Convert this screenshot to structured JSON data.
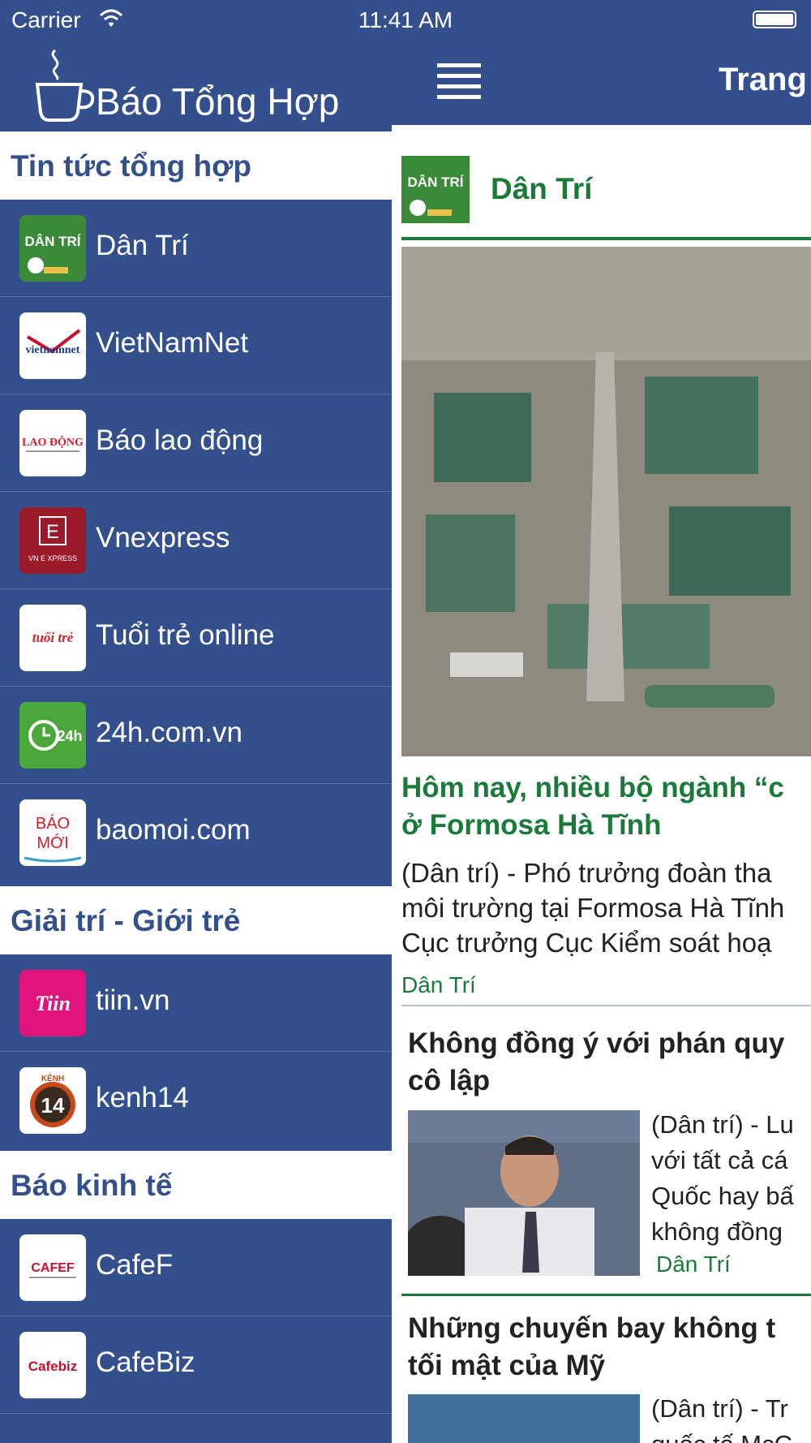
{
  "status_bar": {
    "carrier": "Carrier",
    "time": "11:41 AM"
  },
  "brand": {
    "title": "Báo Tổng Hợp"
  },
  "sidebar": {
    "sections": [
      {
        "title": "Tin tức tổng hợp",
        "items": [
          {
            "label": "Dân Trí",
            "logo": "dantri-logo"
          },
          {
            "label": "VietNamNet",
            "logo": "vietnamnet-logo"
          },
          {
            "label": "Báo lao động",
            "logo": "laodong-logo"
          },
          {
            "label": "Vnexpress",
            "logo": "vnexpress-logo"
          },
          {
            "label": "Tuổi trẻ online",
            "logo": "tuoitre-logo"
          },
          {
            "label": "24h.com.vn",
            "logo": "24h-logo"
          },
          {
            "label": "baomoi.com",
            "logo": "baomoi-logo"
          }
        ]
      },
      {
        "title": "Giải trí - Giới trẻ",
        "items": [
          {
            "label": "tiin.vn",
            "logo": "tiin-logo"
          },
          {
            "label": "kenh14",
            "logo": "kenh14-logo"
          }
        ]
      },
      {
        "title": "Báo kinh tế",
        "items": [
          {
            "label": "CafeF",
            "logo": "cafef-logo"
          },
          {
            "label": "CafeBiz",
            "logo": "cafebiz-logo"
          }
        ]
      }
    ]
  },
  "logo_text": {
    "dantri": "DÂN TRÍ",
    "vietnamnet": "vietnamnet",
    "laodong": "LAO ĐỘNG",
    "vnexpress_letter": "E",
    "vnexpress_small": "VN E XPRESS",
    "tuoitre": "tuổi trẻ",
    "h24": "24h",
    "baomoi_1": "BÁO",
    "baomoi_2": "MỚI",
    "tiin": "Tiin",
    "kenh14_top": "KÊNH",
    "kenh14_num": "14",
    "cafef": "CAFEF",
    "cafebiz": "Cafebiz"
  },
  "main": {
    "page_title": "Trang",
    "source_name": "Dân Trí",
    "featured": {
      "headline_line1": "Hôm nay, nhiều bộ ngành “c",
      "headline_line2": "ở Formosa Hà Tĩnh",
      "summary_line1": "(Dân trí) - Phó trưởng đoàn tha",
      "summary_line2": "môi trường tại Formosa Hà Tĩnh",
      "summary_line3": "Cục trưởng Cục Kiểm soát hoạ",
      "source": "Dân Trí"
    },
    "articles": [
      {
        "title_line1": "Không đồng ý với phán quy",
        "title_line2": "cô lập",
        "text_lines": [
          "(Dân trí) - Lu",
          "với tất cả cá",
          "Quốc hay bấ",
          "không đồng"
        ],
        "source": "Dân Trí"
      },
      {
        "title_line1": "Những chuyến bay không t",
        "title_line2": "tối mật của Mỹ",
        "text_lines": [
          "(Dân trí) - Tr",
          "quốc tế McC"
        ],
        "source": ""
      }
    ]
  },
  "colors": {
    "primary": "#34508c",
    "accent_green": "#1a7a3a",
    "text": "#222222"
  }
}
